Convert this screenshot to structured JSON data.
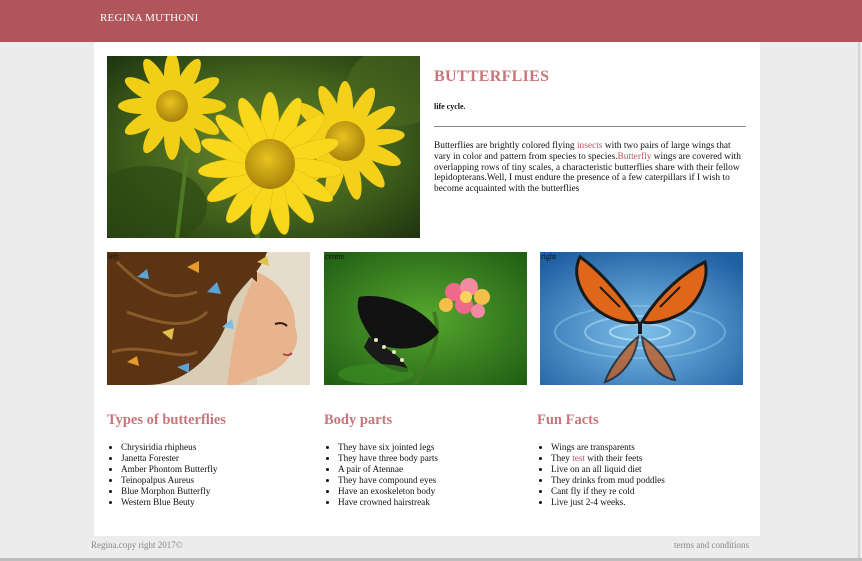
{
  "header": {
    "brand": "REGINA MUTHONI"
  },
  "hero": {
    "title": "BUTTERFLIES",
    "subtitle": "life cycle.",
    "body_1": "Butterflies are brightly colored flying ",
    "link_1": "insects",
    "body_2": " with two pairs of large wings that vary in color and pattern from species to species.",
    "link_2": "Butterfly",
    "body_3": " wings are covered with overlapping rows of tiny scales, a characteristic butterflies share with their fellow lepidopterans.Well, I must endure the presence of a few caterpillars if I wish to become acquainted with the butterflies"
  },
  "gallery": [
    {
      "caption": "left"
    },
    {
      "caption": "centre"
    },
    {
      "caption": "right"
    }
  ],
  "columns": {
    "types": {
      "title": "Types of butterflies",
      "items": [
        "Chrysiridia rhipheus",
        "Janetta Forester",
        "Amber Phontom Butterfly",
        "Teinopalpus Aureus",
        "Blue Morphon Butterfly",
        "Western Blue Beuty"
      ]
    },
    "body": {
      "title": "Body parts",
      "items": [
        "They have six jointed legs",
        "They have three body parts",
        "A pair of Atennae",
        "They have compound eyes",
        "Have an exoskeleton body",
        "Have crowned hairstreak"
      ]
    },
    "facts": {
      "title": "Fun Facts",
      "items": [
        "Wings are transparents",
        "Live on an all liquid diet",
        "They drinks from mud poddles",
        "Cant fly if they re cold",
        "Live just 2-4 weeks."
      ],
      "item2_prefix": "They ",
      "item2_link": "test",
      "item2_suffix": " with their feets"
    }
  },
  "footer": {
    "copyright": "Regina.copy right 2017©",
    "terms": "terms and conditions"
  },
  "colors": {
    "header": "#b0555a",
    "accent": "#c8767a",
    "link": "#b5555e"
  },
  "icons": [
    "flower-image",
    "woman-butterflies-image",
    "black-butterfly-image",
    "monarch-butterfly-image"
  ]
}
